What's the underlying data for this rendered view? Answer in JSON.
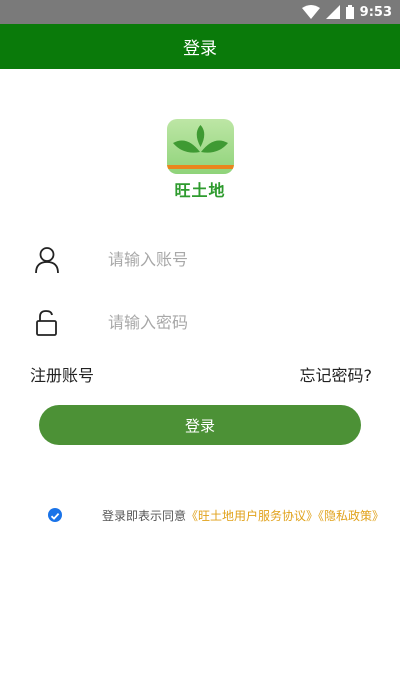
{
  "status_bar": {
    "time": "9:53",
    "icons": [
      "wifi-icon",
      "signal-icon",
      "battery-icon"
    ]
  },
  "app_bar": {
    "title": "登录"
  },
  "logo": {
    "name": "旺土地",
    "colors": {
      "leaf": "#3f9a33",
      "stripe": "#e9861c"
    }
  },
  "form": {
    "account": {
      "placeholder": "请输入账号",
      "value": "",
      "icon": "user-icon"
    },
    "password": {
      "placeholder": "请输入密码",
      "value": "",
      "icon": "lock-icon"
    }
  },
  "links": {
    "register": "注册账号",
    "forgot": "忘记密码?"
  },
  "login_button": {
    "label": "登录",
    "color": "#4c9136"
  },
  "agreement": {
    "checked": true,
    "prefix": "登录即表示同意",
    "service_link": "《旺土地用户服务协议》",
    "privacy_link": "《隐私政策》",
    "link_color": "#e1a21b"
  }
}
